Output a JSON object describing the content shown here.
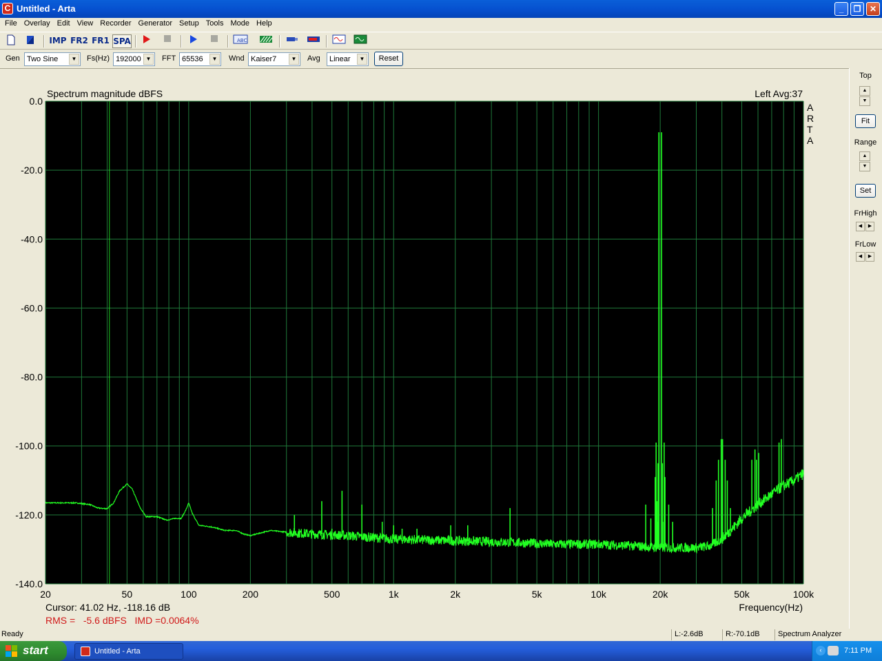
{
  "window": {
    "title": "Untitled - Arta",
    "app_icon": "arta-app-icon",
    "minimize_glyph": "_",
    "maximize_glyph": "❐",
    "close_glyph": "✕"
  },
  "menu": [
    "File",
    "Overlay",
    "Edit",
    "View",
    "Recorder",
    "Generator",
    "Setup",
    "Tools",
    "Mode",
    "Help"
  ],
  "toolbar": {
    "imp_label": "IMP",
    "fr2_label": "FR2",
    "fr1_label": "FR1",
    "spa_label": "SPA",
    "abc_label": "ABC"
  },
  "controls": {
    "gen_label": "Gen",
    "gen_value": "Two Sine",
    "fs_label": "Fs(Hz)",
    "fs_value": "192000",
    "fft_label": "FFT",
    "fft_value": "65536",
    "wnd_label": "Wnd",
    "wnd_value": "Kaiser7",
    "avg_label": "Avg",
    "avg_value": "Linear",
    "reset_label": "Reset"
  },
  "right_panel": {
    "top_label": "Top",
    "fit_label": "Fit",
    "range_label": "Range",
    "set_label": "Set",
    "frhigh_label": "FrHigh",
    "frlow_label": "FrLow"
  },
  "readouts": {
    "cursor": "Cursor: 41.02 Hz, -118.16 dB",
    "rms": "RMS =   -5.6 dBFS   IMD =0.0064%"
  },
  "chart_data": {
    "type": "line",
    "title": "Spectrum magnitude dBFS",
    "channel_info": "Left   Avg:37",
    "watermark": "ARTA",
    "xlabel": "Frequency(Hz)",
    "ylabel": "",
    "x_scale": "log",
    "xlim": [
      20,
      100000
    ],
    "ylim": [
      -140,
      0
    ],
    "x_tick_labels": [
      "20",
      "50",
      "100",
      "200",
      "500",
      "1k",
      "2k",
      "5k",
      "10k",
      "20k",
      "50k",
      "100k"
    ],
    "x_tick_values": [
      20,
      50,
      100,
      200,
      500,
      1000,
      2000,
      5000,
      10000,
      20000,
      50000,
      100000
    ],
    "y_tick_labels": [
      "0.0",
      "-20.0",
      "-40.0",
      "-60.0",
      "-80.0",
      "-100.0",
      "-120.0",
      "-140.0"
    ],
    "y_tick_values": [
      0,
      -20,
      -40,
      -60,
      -80,
      -100,
      -120,
      -140
    ],
    "grid": true,
    "colors": {
      "background": "#000000",
      "grid": "#1f7a3a",
      "trace": "#22ff22",
      "axis_text": "#000000"
    },
    "series": [
      {
        "name": "Left",
        "baseline": [
          [
            20,
            -116.5
          ],
          [
            28,
            -116.5
          ],
          [
            33,
            -117
          ],
          [
            36,
            -118
          ],
          [
            40,
            -118.2
          ],
          [
            43,
            -116.5
          ],
          [
            46,
            -113
          ],
          [
            50,
            -111
          ],
          [
            53,
            -112.5
          ],
          [
            58,
            -118
          ],
          [
            62,
            -120.5
          ],
          [
            70,
            -120.5
          ],
          [
            78,
            -121.5
          ],
          [
            86,
            -121
          ],
          [
            92,
            -121
          ],
          [
            97,
            -118.5
          ],
          [
            100,
            -116.5
          ],
          [
            104,
            -119.5
          ],
          [
            112,
            -123
          ],
          [
            130,
            -123.5
          ],
          [
            150,
            -124.5
          ],
          [
            170,
            -124.5
          ],
          [
            185,
            -125.5
          ],
          [
            200,
            -126
          ],
          [
            250,
            -124.5
          ],
          [
            300,
            -125
          ],
          [
            400,
            -125.5
          ],
          [
            600,
            -126
          ],
          [
            1000,
            -127
          ],
          [
            2000,
            -127.5
          ],
          [
            4000,
            -128
          ],
          [
            6000,
            -128.5
          ],
          [
            10000,
            -128.5
          ],
          [
            15000,
            -129
          ],
          [
            20000,
            -129.5
          ],
          [
            25000,
            -129.5
          ],
          [
            30000,
            -129.5
          ],
          [
            35000,
            -129
          ],
          [
            40000,
            -127
          ],
          [
            45000,
            -124
          ],
          [
            50000,
            -121
          ],
          [
            60000,
            -117
          ],
          [
            70000,
            -114
          ],
          [
            80000,
            -111.5
          ],
          [
            90000,
            -110
          ],
          [
            100000,
            -108
          ]
        ],
        "peaks": [
          [
            328,
            -120
          ],
          [
            446,
            -116
          ],
          [
            500,
            -124
          ],
          [
            560,
            -113
          ],
          [
            700,
            -117
          ],
          [
            880,
            -122
          ],
          [
            1000,
            -123
          ],
          [
            1100,
            -124
          ],
          [
            1300,
            -124
          ],
          [
            1900,
            -123
          ],
          [
            2300,
            -123
          ],
          [
            3700,
            -118
          ],
          [
            18900,
            -109
          ],
          [
            19100,
            -99
          ],
          [
            19250,
            -116
          ],
          [
            19440,
            -122
          ],
          [
            19510,
            -105
          ],
          [
            19700,
            -9
          ],
          [
            20300,
            -9
          ],
          [
            20500,
            -105
          ],
          [
            20580,
            -122
          ],
          [
            20900,
            -99
          ],
          [
            21100,
            -109
          ],
          [
            22000,
            -117
          ],
          [
            23000,
            -122
          ],
          [
            17000,
            -117
          ],
          [
            18000,
            -121
          ],
          [
            36000,
            -118
          ],
          [
            37500,
            -110
          ],
          [
            38500,
            -104
          ],
          [
            39700,
            -98
          ],
          [
            40300,
            -98
          ],
          [
            41500,
            -104
          ],
          [
            42500,
            -110
          ],
          [
            44000,
            -118
          ],
          [
            56000,
            -104
          ],
          [
            58000,
            -101
          ],
          [
            59000,
            -104
          ],
          [
            60500,
            -102
          ],
          [
            76000,
            -99
          ],
          [
            78000,
            -98
          ]
        ]
      }
    ]
  },
  "status": {
    "left": "Ready",
    "l_level": "L:-2.6dB",
    "r_level": "R:-70.1dB",
    "mode": "Spectrum Analyzer"
  },
  "taskbar": {
    "start_label": "start",
    "task_label": "Untitled - Arta",
    "tray_chevron": "‹",
    "clock": "7:11 PM"
  }
}
